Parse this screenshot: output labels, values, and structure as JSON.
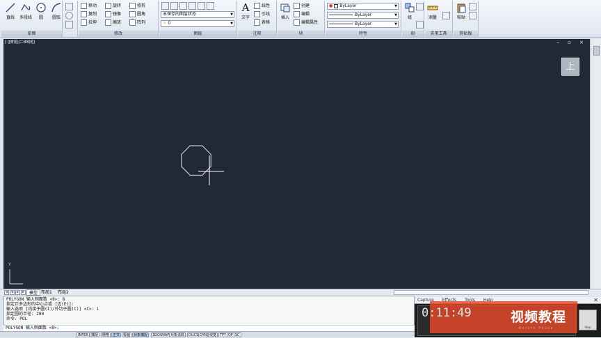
{
  "ribbon": {
    "draw": {
      "title": "绘图",
      "big_buttons": [
        "直线",
        "多段线",
        "圆",
        "圆弧"
      ]
    },
    "modify": {
      "title": "修改",
      "items": [
        "移动",
        "旋转",
        "修剪",
        "复制",
        "镜像",
        "圆角",
        "拉伸",
        "缩放",
        "阵列"
      ]
    },
    "layers": {
      "title": "图层",
      "layer_state": "未保存的图层状态",
      "current_layer": "0"
    },
    "annotation": {
      "title": "注释",
      "big_button": "文字",
      "items": [
        "线性",
        "引线",
        "表格"
      ]
    },
    "block": {
      "title": "块",
      "big_button": "插入",
      "items": [
        "创建",
        "编辑",
        "编辑属性"
      ]
    },
    "properties": {
      "title": "特性",
      "color": "ByLayer",
      "linetype": "ByLayer",
      "lineweight": "ByLayer"
    },
    "group": {
      "title": "组",
      "label": "组"
    },
    "utilities": {
      "title": "实用工具",
      "label": "测量"
    },
    "clipboard": {
      "title": "剪贴板",
      "label": "粘贴"
    }
  },
  "viewport": {
    "label": "[-][俯视][二维线框]",
    "viewcube": "上",
    "ucs_label": "Y",
    "background": "#222936"
  },
  "layout_tabs": [
    "模型",
    "布局1",
    "布局2"
  ],
  "command": {
    "history": [
      "POLYGON 输入侧面数 <8>: 8",
      "指定正多边形的中心点或 [边(E)]:",
      "输入选项 [内接于圆(I)/外切于圆(C)] <C>: i",
      "指定圆的半径: 200",
      "命令: POL"
    ],
    "prompt": "POLYGON 输入侧面数 <8>:"
  },
  "status_buttons": [
    "INFER",
    "捕捉",
    "栅格",
    "正交",
    "极轴",
    "对象捕捉",
    "3DOSNAP",
    "对象追踪",
    "DUCS",
    "DYN",
    "线宽",
    "TPY",
    "QP",
    "SC"
  ],
  "recorder": {
    "menu": [
      "Capture",
      "Effects",
      "Tools",
      "Help"
    ],
    "timer": "0:11:49",
    "banner": "视频教程",
    "buttons": "Delete Pause",
    "stop": "Stop"
  }
}
